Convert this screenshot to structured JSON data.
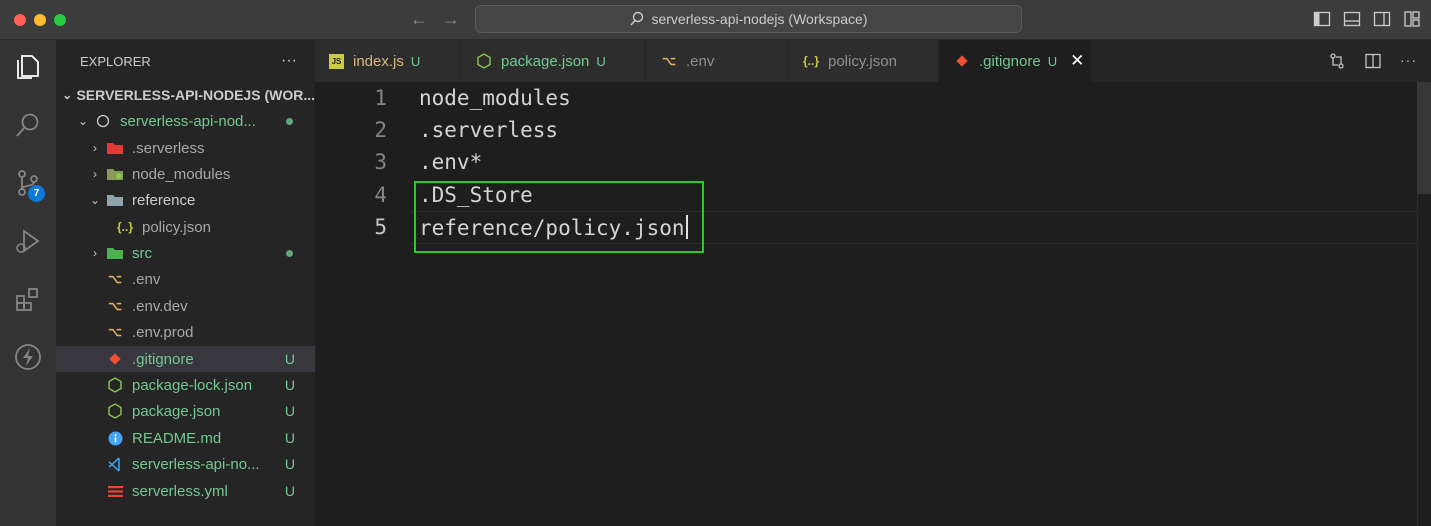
{
  "window": {
    "title": "serverless-api-nodejs (Workspace)"
  },
  "explorer": {
    "header": "EXPLORER",
    "more": "···",
    "workspace_label": "SERVERLESS-API-NODEJS (WOR...",
    "root_folder": "serverless-api-nod...",
    "items": [
      {
        "label": ".serverless",
        "icon": "serverless-folder-icon",
        "status": ""
      },
      {
        "label": "node_modules",
        "icon": "node-folder-icon",
        "status": ""
      },
      {
        "label": "reference",
        "icon": "folder-open-icon",
        "status": ""
      },
      {
        "label": "policy.json",
        "icon": "json-icon",
        "status": ""
      },
      {
        "label": "src",
        "icon": "src-folder-icon",
        "status": ""
      },
      {
        "label": ".env",
        "icon": "env-icon",
        "status": ""
      },
      {
        "label": ".env.dev",
        "icon": "env-icon",
        "status": ""
      },
      {
        "label": ".env.prod",
        "icon": "env-icon",
        "status": ""
      },
      {
        "label": ".gitignore",
        "icon": "git-icon",
        "status": "U"
      },
      {
        "label": "package-lock.json",
        "icon": "nodejs-icon",
        "status": "U"
      },
      {
        "label": "package.json",
        "icon": "nodejs-icon",
        "status": "U"
      },
      {
        "label": "README.md",
        "icon": "info-icon",
        "status": "U"
      },
      {
        "label": "serverless-api-no...",
        "icon": "vscode-icon",
        "status": "U"
      },
      {
        "label": "serverless.yml",
        "icon": "yaml-icon",
        "status": "U"
      }
    ]
  },
  "activity": {
    "source_control_badge": "7"
  },
  "tabs": [
    {
      "label": "index.js",
      "status": "U",
      "icon": "js-icon"
    },
    {
      "label": "package.json",
      "status": "U",
      "icon": "nodejs-icon"
    },
    {
      "label": ".env",
      "status": "",
      "icon": "env-icon"
    },
    {
      "label": "policy.json",
      "status": "",
      "icon": "json-icon"
    },
    {
      "label": ".gitignore",
      "status": "U",
      "icon": "git-icon",
      "close": "✕"
    }
  ],
  "editor": {
    "lines": [
      {
        "number": "1",
        "text": "node_modules"
      },
      {
        "number": "2",
        "text": ".serverless"
      },
      {
        "number": "3",
        "text": ".env*"
      },
      {
        "number": "4",
        "text": ".DS_Store"
      },
      {
        "number": "5",
        "text": "reference/policy.json"
      }
    ]
  },
  "colors": {
    "accent_green": "#73c991",
    "highlight_box": "#2ec92e",
    "badge_blue": "#0a7ad6"
  }
}
